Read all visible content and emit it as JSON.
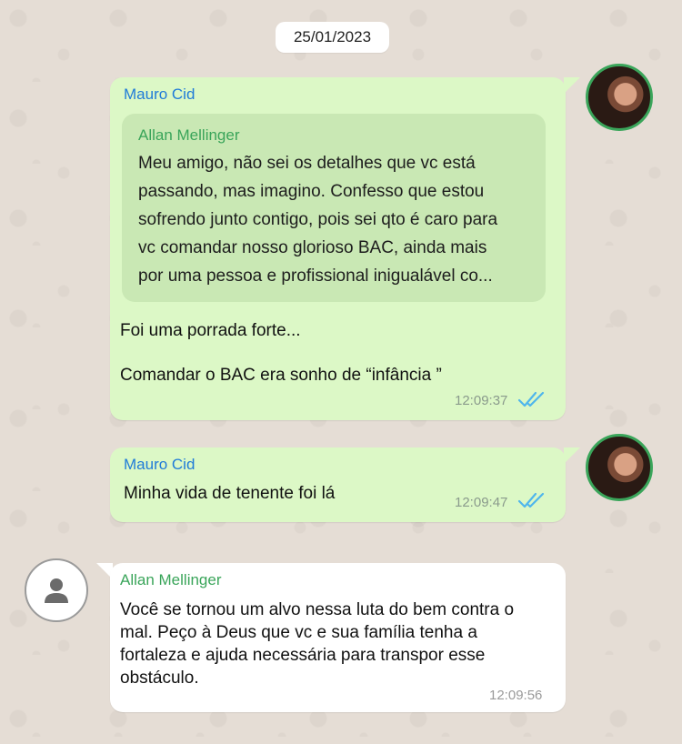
{
  "date_chip": "25/01/2023",
  "messages": [
    {
      "sender": "Mauro Cid",
      "quoted": {
        "sender": "Allan Mellinger",
        "lines": [
          "Meu amigo, não sei os detalhes que vc está",
          "passando, mas imagino. Confesso que estou",
          "sofrendo junto contigo, pois sei qto é caro para",
          "vc comandar nosso glorioso BAC, ainda mais",
          "por uma pessoa e profissional inigualável co..."
        ]
      },
      "line1": "Foi uma porrada forte...",
      "line2": "Comandar o BAC era sonho de “infância ”",
      "time": "12:09:37"
    },
    {
      "sender": "Mauro Cid",
      "text": "Minha vida de tenente foi lá",
      "time": "12:09:47"
    },
    {
      "sender": "Allan Mellinger",
      "lines": [
        "Você se tornou um alvo nessa luta do bem contra o",
        "mal. Peço à Deus que vc e sua família tenha a",
        "fortaleza e ajuda necessária para transpor esse",
        "obstáculo."
      ],
      "time": "12:09:56"
    }
  ],
  "colors": {
    "outgoing_bubble": "#dcf8c6",
    "incoming_bubble": "#ffffff",
    "quote_bg": "#c9e8b4",
    "sender_blue": "#1f7bd8",
    "sender_green": "#3aa55a",
    "read_ticks": "#4fb6ec"
  }
}
